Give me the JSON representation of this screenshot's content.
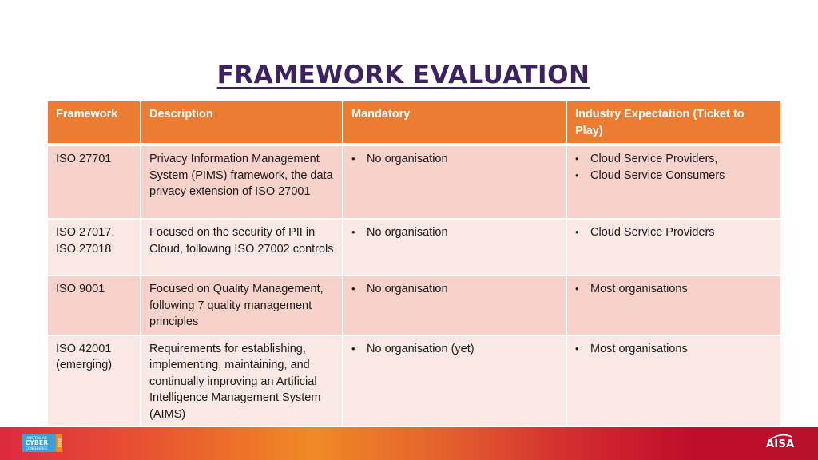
{
  "slide": {
    "title": "FRAMEWORK EVALUATION"
  },
  "table": {
    "headers": {
      "framework": "Framework",
      "description": "Description",
      "mandatory": "Mandatory",
      "industry": "Industry Expectation (Ticket to Play)"
    },
    "rows": [
      {
        "framework": "ISO 27701",
        "description": "Privacy Information Management System (PIMS) framework, the data privacy extension of ISO 27001",
        "mandatory": [
          "No organisation"
        ],
        "industry": [
          "Cloud Service Providers,",
          "Cloud Service Consumers"
        ]
      },
      {
        "framework": "ISO 27017, ISO 27018",
        "description": "Focused on the security of PII in Cloud, following ISO 27002 controls",
        "mandatory": [
          "No organisation"
        ],
        "industry": [
          "Cloud Service Providers"
        ]
      },
      {
        "framework": "ISO 9001",
        "description": "Focused on Quality Management, following 7 quality management principles",
        "mandatory": [
          "No organisation"
        ],
        "industry": [
          "Most organisations"
        ]
      },
      {
        "framework": "ISO 42001 (emerging)",
        "description": "Requirements for establishing, implementing, maintaining, and continually improving an Artificial Intelligence Management System (AIMS)",
        "mandatory": [
          "No organisation (yet)"
        ],
        "industry": [
          "Most organisations"
        ]
      }
    ],
    "bullet_glyph": "•"
  },
  "footer": {
    "left_logo": {
      "line1": "AUSTRALIAN",
      "line2": "CYBER",
      "line3": "CONFERENCE",
      "year": "2024"
    },
    "right_logo": "AISA"
  },
  "colors": {
    "title": "#3e2260",
    "header_bg": "#ec7c31",
    "row_odd": "#f7d2cb",
    "row_even": "#fae8e5",
    "footer_left": "#de2a3f",
    "footer_mid": "#f08a25",
    "footer_right": "#b8102c",
    "acc_logo_blue": "#3aa0d8"
  }
}
